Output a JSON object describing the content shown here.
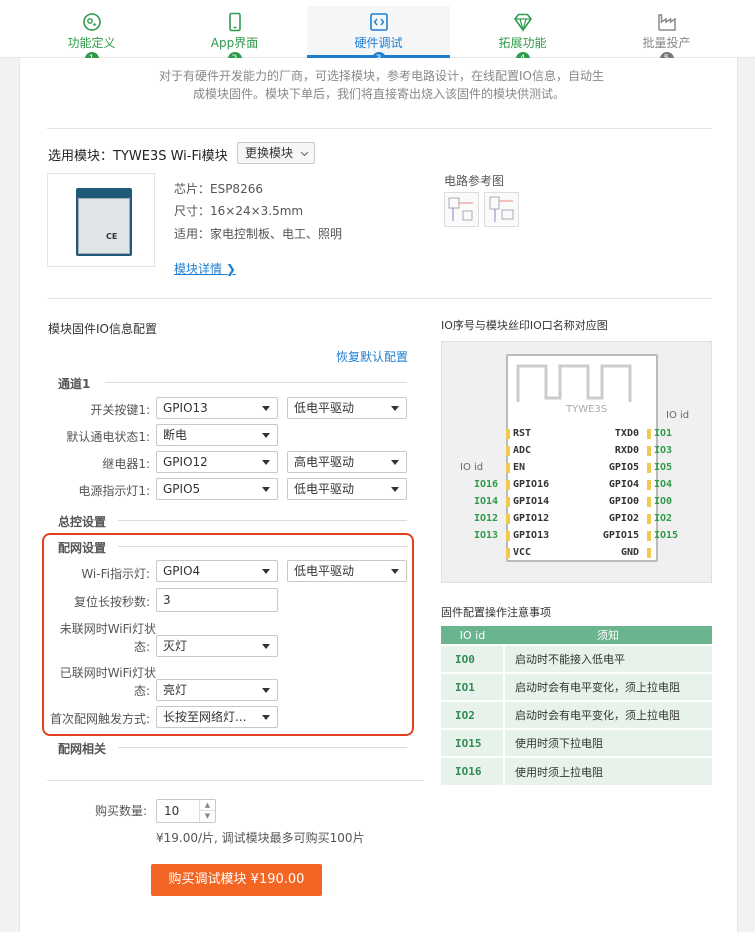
{
  "colors": {
    "accent": "#1e7fd0",
    "step_done": "#2f9a4a",
    "step_todo": "#8a8a8a",
    "buy": "#f26522",
    "highlight": "#e3411f",
    "id_green": "#2f9a4a"
  },
  "steps": [
    {
      "label": "功能定义",
      "num": "1",
      "state": "done",
      "icon": "settings-icon"
    },
    {
      "label": "App界面",
      "num": "2",
      "state": "done",
      "icon": "phone-icon"
    },
    {
      "label": "硬件调试",
      "num": "3",
      "state": "active",
      "icon": "code-icon"
    },
    {
      "label": "拓展功能",
      "num": "4",
      "state": "done",
      "icon": "diamond-icon"
    },
    {
      "label": "批量投产",
      "num": "5",
      "state": "todo",
      "icon": "factory-icon"
    }
  ],
  "intro": {
    "line1": "对于有硬件开发能力的厂商，可选择模块，参考电路设计，在线配置IO信息，自动生",
    "line2": "成模块固件。模块下单后，我们将直接寄出烧入该固件的模块供测试。"
  },
  "module": {
    "selected_label": "选用模块：TYWE3S Wi-Fi模块",
    "change_label": "更换模块",
    "chip": "芯片：ESP8266",
    "size": "尺寸：16×24×3.5mm",
    "usage": "适用：家电控制板、电工、照明",
    "detail_link": "模块详情",
    "circuit_label": "电路参考图"
  },
  "io_config": {
    "title": "模块固件IO信息配置",
    "reset_link": "恢复默认配置",
    "channel_title": "通道1",
    "rows": [
      {
        "label": "开关按键1:",
        "value": "GPIO13",
        "mode": "低电平驱动"
      },
      {
        "label": "默认通电状态1:",
        "value": "断电",
        "mode": ""
      },
      {
        "label": "继电器1:",
        "value": "GPIO12",
        "mode": "高电平驱动"
      },
      {
        "label": "电源指示灯1:",
        "value": "GPIO5",
        "mode": "低电平驱动"
      }
    ],
    "master_title": "总控设置",
    "network_title": "配网设置",
    "wifi_led_label": "Wi-Fi指示灯:",
    "wifi_led_value": "GPIO4",
    "wifi_led_mode": "低电平驱动",
    "reset_sec_label": "复位长按秒数:",
    "reset_sec_value": "3",
    "unconnected_label_1": "未联网时WiFi灯状",
    "unconnected_label_2": "态:",
    "unconnected_value": "灭灯",
    "connected_label_1": "已联网时WiFi灯状",
    "connected_label_2": "态:",
    "connected_value": "亮灯",
    "trigger_label": "首次配网触发方式:",
    "trigger_value": "长按至网络灯...",
    "related_title": "配网相关"
  },
  "diagram": {
    "title": "IO序号与模块丝印IO口名称对应图",
    "module_name": "TYWE3S",
    "io_id_label": "IO id",
    "left_pins": [
      {
        "id": "",
        "name": "RST"
      },
      {
        "id": "",
        "name": "ADC"
      },
      {
        "id": "",
        "name": "EN"
      },
      {
        "id": "IO16",
        "name": "GPIO16"
      },
      {
        "id": "IO14",
        "name": "GPIO14"
      },
      {
        "id": "IO12",
        "name": "GPIO12"
      },
      {
        "id": "IO13",
        "name": "GPIO13"
      },
      {
        "id": "",
        "name": "VCC"
      }
    ],
    "right_pins": [
      {
        "id": "IO1",
        "name": "TXD0"
      },
      {
        "id": "IO3",
        "name": "RXD0"
      },
      {
        "id": "IO5",
        "name": "GPIO5"
      },
      {
        "id": "IO4",
        "name": "GPIO4"
      },
      {
        "id": "IO0",
        "name": "GPIO0"
      },
      {
        "id": "IO2",
        "name": "GPIO2"
      },
      {
        "id": "IO15",
        "name": "GPIO15"
      },
      {
        "id": "",
        "name": "GND"
      }
    ]
  },
  "notes": {
    "title": "固件配置操作注意事项",
    "head_id": "IO id",
    "head_note": "须知",
    "rows": [
      {
        "id": "IO0",
        "note": "启动时不能接入低电平"
      },
      {
        "id": "IO1",
        "note": "启动时会有电平变化，须上拉电阻"
      },
      {
        "id": "IO2",
        "note": "启动时会有电平变化，须上拉电阻"
      },
      {
        "id": "IO15",
        "note": "使用时须下拉电阻"
      },
      {
        "id": "IO16",
        "note": "使用时须上拉电阻"
      }
    ]
  },
  "purchase": {
    "qty_label": "购买数量:",
    "qty_value": "10",
    "price_note": "¥19.00/片, 调试模块最多可购买100片",
    "buy_label": "购买调试模块 ¥190.00"
  }
}
